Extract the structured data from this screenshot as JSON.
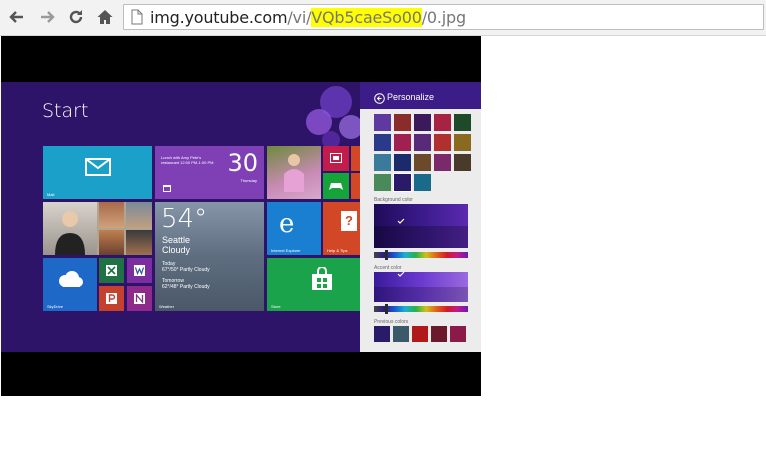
{
  "browser": {
    "url_host": "img.youtube.com",
    "url_path_prefix": "/vi/",
    "url_highlight": "VQb5caeSo00",
    "url_suffix": "/0.jpg"
  },
  "start_screen": {
    "title": "Start",
    "tiles": {
      "mail_label": "Mail",
      "calendar_event": "Lunch with Amy Pete's restaurant 12:00 PM-1:00 PM",
      "calendar_day": "30",
      "calendar_weekday": "Thursday",
      "weather_temp": "54°",
      "weather_city": "Seattle",
      "weather_condition": "Cloudy",
      "weather_today": "Today",
      "weather_today_forecast": "67°/50° Partly Cloudy",
      "weather_tomorrow": "Tomorrow",
      "weather_tomorrow_forecast": "62°/48° Partly Cloudy",
      "weather_label": "Weather",
      "ie_label": "Internet Explorer",
      "help_label": "Help & Tips",
      "skydrive_label": "SkyDrive",
      "store_label": "Store"
    }
  },
  "personalize": {
    "title": "Personalize",
    "background_color_label": "Background color",
    "accent_color_label": "Accent color",
    "previous_colors_label": "Previous colors"
  }
}
